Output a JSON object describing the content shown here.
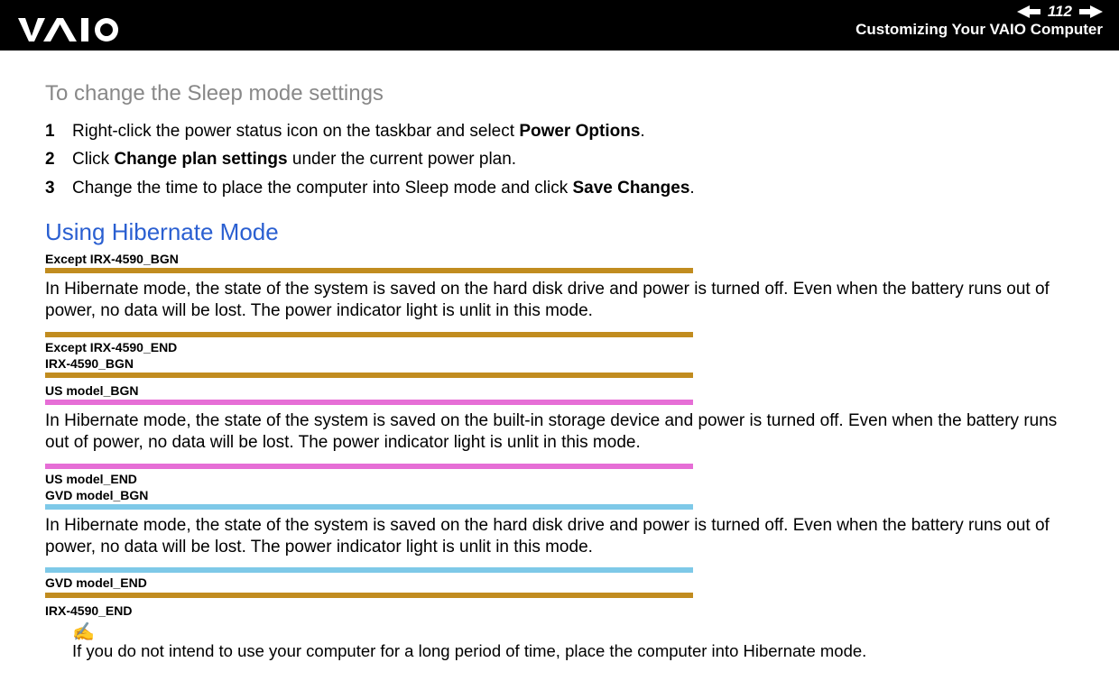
{
  "header": {
    "page_number": "112",
    "section_title": "Customizing Your VAIO Computer"
  },
  "content": {
    "sleep_heading": "To change the Sleep mode settings",
    "steps": [
      {
        "num": "1",
        "pre": "Right-click the power status icon on the taskbar and select ",
        "bold": "Power Options",
        "post": "."
      },
      {
        "num": "2",
        "pre": "Click ",
        "bold": "Change plan settings",
        "post": " under the current power plan."
      },
      {
        "num": "3",
        "pre": "Change the time to place the computer into Sleep mode and click ",
        "bold": "Save Changes",
        "post": "."
      }
    ],
    "hibernate_heading": "Using Hibernate Mode",
    "tags": {
      "except_irx_bgn": "Except IRX-4590_BGN",
      "except_irx_end": "Except IRX-4590_END",
      "irx_bgn": "IRX-4590_BGN",
      "us_bgn": "US model_BGN",
      "us_end": "US model_END",
      "gvd_bgn": "GVD model_BGN",
      "gvd_end": "GVD model_END",
      "irx_end": "IRX-4590_END"
    },
    "para_hdd": "In Hibernate mode, the state of the system is saved on the hard disk drive and power is turned off. Even when the battery runs out of power, no data will be lost. The power indicator light is unlit in this mode.",
    "para_builtin": "In Hibernate mode, the state of the system is saved on the built-in storage device and power is turned off. Even when the battery runs out of power, no data will be lost. The power indicator light is unlit in this mode.",
    "note_icon": "✍",
    "note_text": "If you do not intend to use your computer for a long period of time, place the computer into Hibernate mode."
  }
}
